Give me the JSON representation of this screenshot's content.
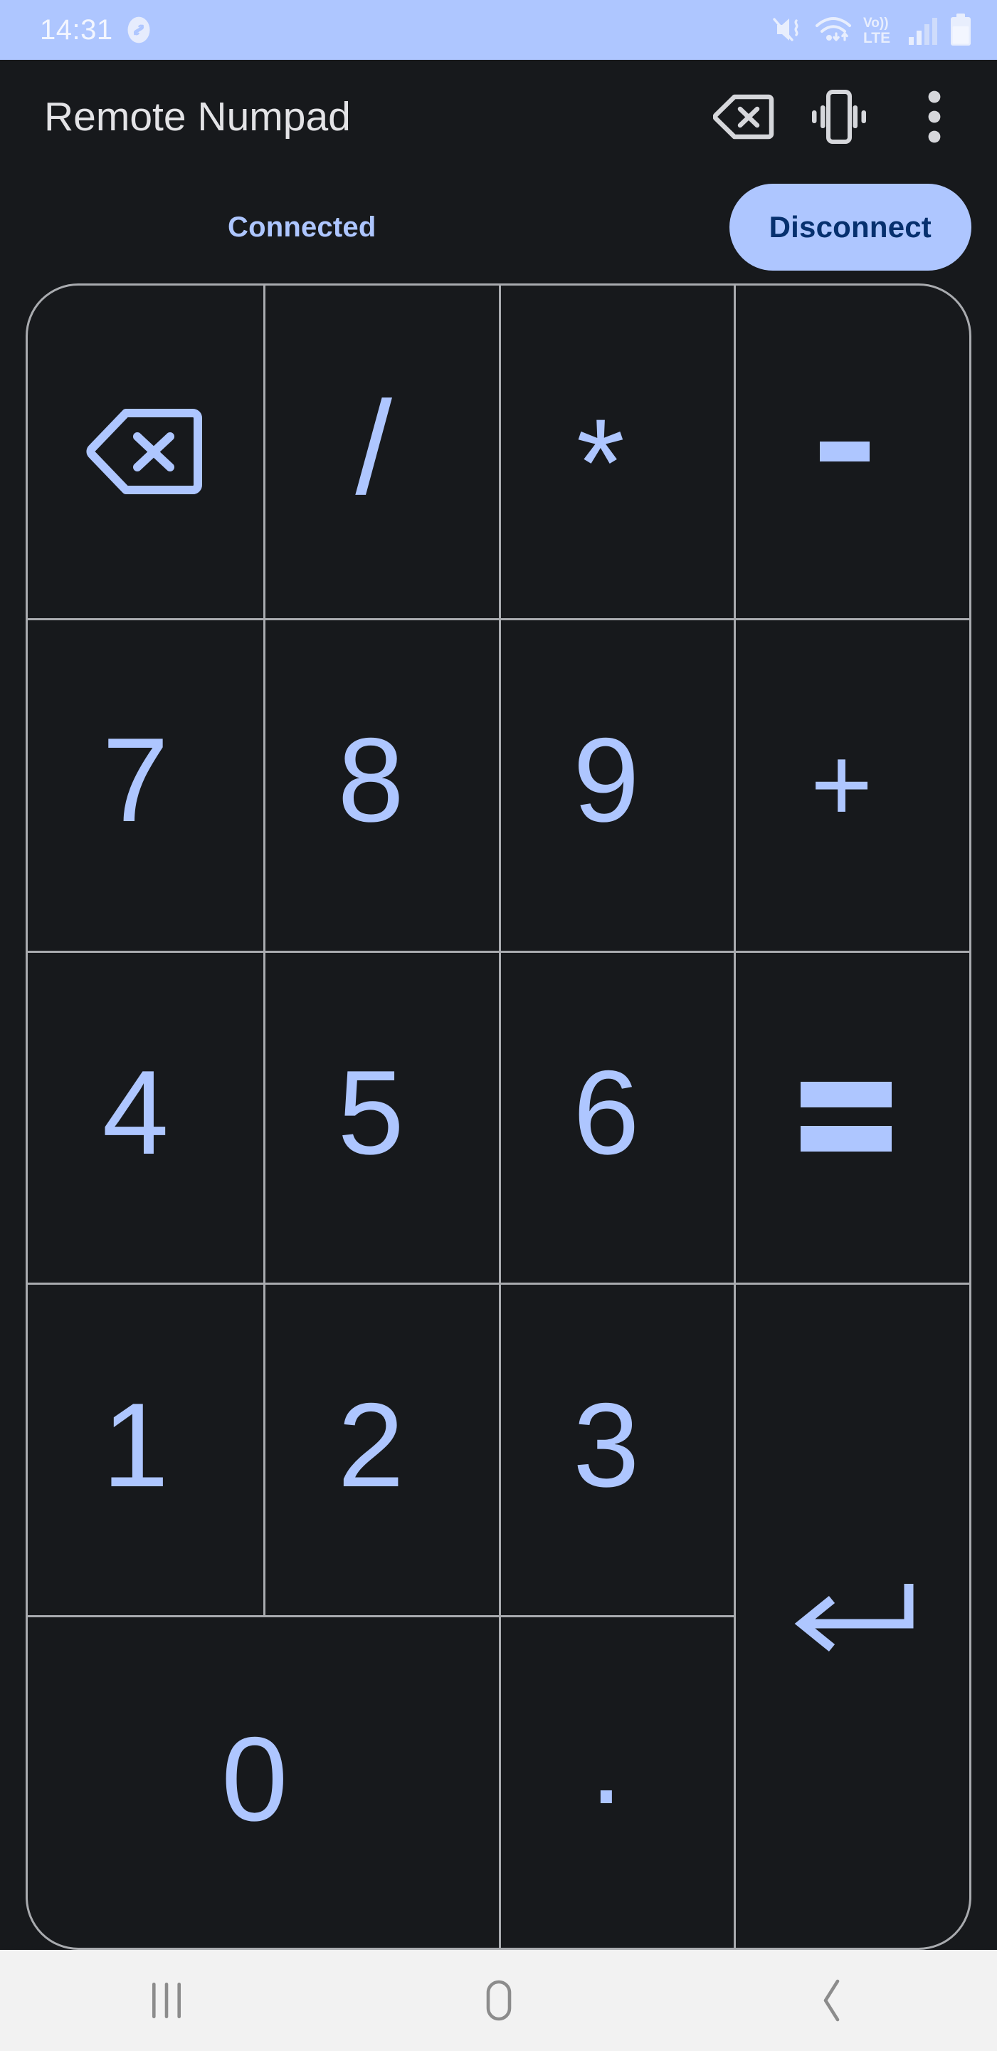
{
  "status_bar": {
    "time": "14:31",
    "bg_color": "#aec6ff",
    "text_color": "#f3f6ff",
    "left_icons": [
      {
        "name": "shazam-icon",
        "label": "Shazam"
      }
    ],
    "right_icons": [
      {
        "name": "mute-vibrate-icon",
        "label": "Sound off / vibrate"
      },
      {
        "name": "wifi-icon",
        "label": "Wi-Fi with data transfer arrows"
      },
      {
        "name": "volte-icon",
        "label": "Vo)) LTE",
        "line1": "Vo))",
        "line2": "LTE"
      },
      {
        "name": "cellular-signal-icon",
        "label": "Mobile signal"
      },
      {
        "name": "battery-icon",
        "label": "Battery"
      }
    ]
  },
  "app_bar": {
    "title": "Remote Numpad",
    "title_color": "#e3e3e6",
    "actions": [
      {
        "name": "backspace-icon",
        "label": "Backspace"
      },
      {
        "name": "vibrate-icon",
        "label": "Vibrate"
      },
      {
        "name": "overflow-menu-icon",
        "label": "More options"
      }
    ]
  },
  "connection": {
    "status_label": "Connected",
    "status_color": "#aec6ff",
    "button_label": "Disconnect",
    "button_bg": "#aec6ff",
    "button_text_color": "#06306e"
  },
  "numpad": {
    "accent_color": "#aec6ff",
    "border_color": "#a9abaf",
    "background": "#17191c",
    "keys": [
      {
        "name": "key-backspace",
        "type": "icon",
        "icon": "backspace-icon",
        "label": "Backspace",
        "row": 1,
        "col": 1
      },
      {
        "name": "key-divide",
        "type": "text",
        "label": "/",
        "row": 1,
        "col": 2
      },
      {
        "name": "key-multiply",
        "type": "text",
        "label": "*",
        "row": 1,
        "col": 3
      },
      {
        "name": "key-minus",
        "type": "shape",
        "label": "-",
        "row": 1,
        "col": 4
      },
      {
        "name": "key-7",
        "type": "text",
        "label": "7",
        "row": 2,
        "col": 1
      },
      {
        "name": "key-8",
        "type": "text",
        "label": "8",
        "row": 2,
        "col": 2
      },
      {
        "name": "key-9",
        "type": "text",
        "label": "9",
        "row": 2,
        "col": 3
      },
      {
        "name": "key-plus",
        "type": "text",
        "label": "+",
        "row": 2,
        "col": 4
      },
      {
        "name": "key-4",
        "type": "text",
        "label": "4",
        "row": 3,
        "col": 1
      },
      {
        "name": "key-5",
        "type": "text",
        "label": "5",
        "row": 3,
        "col": 2
      },
      {
        "name": "key-6",
        "type": "text",
        "label": "6",
        "row": 3,
        "col": 3
      },
      {
        "name": "key-equals",
        "type": "shape",
        "label": "=",
        "row": 3,
        "col": 4
      },
      {
        "name": "key-1",
        "type": "text",
        "label": "1",
        "row": 4,
        "col": 1
      },
      {
        "name": "key-2",
        "type": "text",
        "label": "2",
        "row": 4,
        "col": 2
      },
      {
        "name": "key-3",
        "type": "text",
        "label": "3",
        "row": 4,
        "col": 3
      },
      {
        "name": "key-enter",
        "type": "icon",
        "icon": "enter-arrow-icon",
        "label": "Enter",
        "row": 4,
        "col": 4,
        "rowspan": 2
      },
      {
        "name": "key-0",
        "type": "text",
        "label": "0",
        "row": 5,
        "col": 1,
        "colspan": 2
      },
      {
        "name": "key-decimal",
        "type": "text",
        "label": ".",
        "row": 5,
        "col": 3
      }
    ]
  },
  "nav_bar": {
    "bg_color": "#f2f2f2",
    "icon_color": "#8c8c8c",
    "buttons": [
      {
        "name": "nav-recents-button",
        "label": "Recents"
      },
      {
        "name": "nav-home-button",
        "label": "Home"
      },
      {
        "name": "nav-back-button",
        "label": "Back"
      }
    ]
  }
}
